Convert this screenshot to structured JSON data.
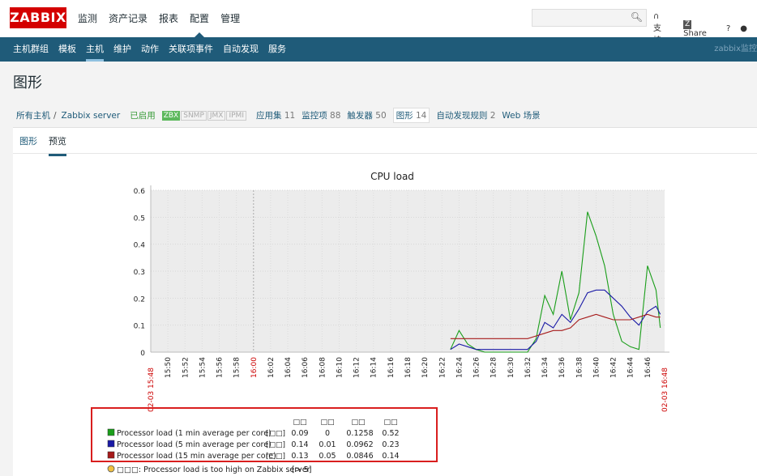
{
  "logo": "ZABBIX",
  "topnav": [
    "监测",
    "资产记录",
    "报表",
    "配置",
    "管理"
  ],
  "toplinks": {
    "support": "支持",
    "share": "Share",
    "help": "?",
    "z": "Z"
  },
  "subnav": [
    "主机群组",
    "模板",
    "主机",
    "维护",
    "动作",
    "关联项事件",
    "自动发现",
    "服务"
  ],
  "user": "zabbix监控",
  "page_title": "图形",
  "breadcrumb": {
    "all_hosts": "所有主机",
    "sep": "/",
    "host": "Zabbix server",
    "enabled": "已启用",
    "badges": [
      "ZBX",
      "SNMP",
      "JMX",
      "IPMI"
    ],
    "items": [
      {
        "label": "应用集",
        "count": "11"
      },
      {
        "label": "监控项",
        "count": "88"
      },
      {
        "label": "触发器",
        "count": "50"
      },
      {
        "label": "图形",
        "count": "14"
      },
      {
        "label": "自动发现规则",
        "count": "2"
      },
      {
        "label": "Web 场景",
        "count": ""
      }
    ]
  },
  "tabs": [
    "图形",
    "预览"
  ],
  "colors": {
    "brand": "#d40000",
    "nav": "#1f5b79",
    "green": "#1a9e1a",
    "blue": "#1a1aa6",
    "red": "#a61a1a",
    "threshold": "#a61a1a"
  },
  "chart_data": {
    "type": "line",
    "title": "CPU load",
    "ylim": [
      0,
      0.6
    ],
    "yticks": [
      "0.6",
      "0.5",
      "0.4",
      "0.3",
      "0.2",
      "0.1",
      "0"
    ],
    "xticks": [
      "15:50",
      "15:52",
      "15:54",
      "15:56",
      "15:58",
      "16:00",
      "16:02",
      "16:04",
      "16:06",
      "16:08",
      "16:10",
      "16:12",
      "16:14",
      "16:16",
      "16:18",
      "16:20",
      "16:22",
      "16:24",
      "16:26",
      "16:28",
      "16:30",
      "16:32",
      "16:34",
      "16:36",
      "16:38",
      "16:40",
      "16:42",
      "16:44",
      "16:46"
    ],
    "x_start_label": "02-03 15:48",
    "x_end_label": "02-03 16:48",
    "series": [
      {
        "name": "Processor load (1 min average per core)",
        "color": "#1a9e1a",
        "points": [
          [
            "16:23",
            0.01
          ],
          [
            "16:24",
            0.08
          ],
          [
            "16:25",
            0.03
          ],
          [
            "16:26",
            0.01
          ],
          [
            "16:27",
            0.0
          ],
          [
            "16:30",
            0.0
          ],
          [
            "16:32",
            0.0
          ],
          [
            "16:33",
            0.05
          ],
          [
            "16:34",
            0.21
          ],
          [
            "16:35",
            0.14
          ],
          [
            "16:36",
            0.3
          ],
          [
            "16:37",
            0.12
          ],
          [
            "16:38",
            0.22
          ],
          [
            "16:39",
            0.52
          ],
          [
            "16:40",
            0.43
          ],
          [
            "16:41",
            0.32
          ],
          [
            "16:42",
            0.14
          ],
          [
            "16:43",
            0.04
          ],
          [
            "16:44",
            0.02
          ],
          [
            "16:45",
            0.01
          ],
          [
            "16:46",
            0.32
          ],
          [
            "16:47",
            0.23
          ],
          [
            "16:47.5",
            0.09
          ]
        ]
      },
      {
        "name": "Processor load (5 min average per core)",
        "color": "#1a1aa6",
        "points": [
          [
            "16:23",
            0.01
          ],
          [
            "16:24",
            0.03
          ],
          [
            "16:25",
            0.02
          ],
          [
            "16:26",
            0.01
          ],
          [
            "16:28",
            0.01
          ],
          [
            "16:30",
            0.01
          ],
          [
            "16:32",
            0.01
          ],
          [
            "16:33",
            0.04
          ],
          [
            "16:34",
            0.11
          ],
          [
            "16:35",
            0.09
          ],
          [
            "16:36",
            0.14
          ],
          [
            "16:37",
            0.11
          ],
          [
            "16:38",
            0.16
          ],
          [
            "16:39",
            0.22
          ],
          [
            "16:40",
            0.23
          ],
          [
            "16:41",
            0.23
          ],
          [
            "16:42",
            0.2
          ],
          [
            "16:43",
            0.17
          ],
          [
            "16:44",
            0.13
          ],
          [
            "16:45",
            0.1
          ],
          [
            "16:46",
            0.15
          ],
          [
            "16:47",
            0.17
          ],
          [
            "16:47.5",
            0.14
          ]
        ]
      },
      {
        "name": "Processor load (15 min average per core)",
        "color": "#a61a1a",
        "points": [
          [
            "16:23",
            0.05
          ],
          [
            "16:32",
            0.05
          ],
          [
            "16:33",
            0.06
          ],
          [
            "16:34",
            0.07
          ],
          [
            "16:35",
            0.08
          ],
          [
            "16:36",
            0.08
          ],
          [
            "16:37",
            0.09
          ],
          [
            "16:38",
            0.12
          ],
          [
            "16:39",
            0.13
          ],
          [
            "16:40",
            0.14
          ],
          [
            "16:41",
            0.13
          ],
          [
            "16:42",
            0.12
          ],
          [
            "16:43",
            0.12
          ],
          [
            "16:44",
            0.12
          ],
          [
            "16:45",
            0.13
          ],
          [
            "16:46",
            0.14
          ],
          [
            "16:47",
            0.13
          ],
          [
            "16:47.5",
            0.13
          ]
        ]
      }
    ],
    "legend": {
      "headers": [
        "□□",
        "□□",
        "□□",
        "□□"
      ],
      "rows": [
        {
          "name": "Processor load (1 min average per core)",
          "func": "[□□]",
          "last": "0.09",
          "min": "0",
          "avg": "0.1258",
          "max": "0.52",
          "color": "#1a9e1a"
        },
        {
          "name": "Processor load (5 min average per core)",
          "func": "[□□]",
          "last": "0.14",
          "min": "0.01",
          "avg": "0.0962",
          "max": "0.23",
          "color": "#1a1aa6"
        },
        {
          "name": "Processor load (15 min average per core)",
          "func": "[□□]",
          "last": "0.13",
          "min": "0.05",
          "avg": "0.0846",
          "max": "0.14",
          "color": "#a61a1a"
        }
      ],
      "trigger": {
        "label": "□□□: Processor load is too high on Zabbix server",
        "cond": "[> 5]"
      }
    }
  }
}
